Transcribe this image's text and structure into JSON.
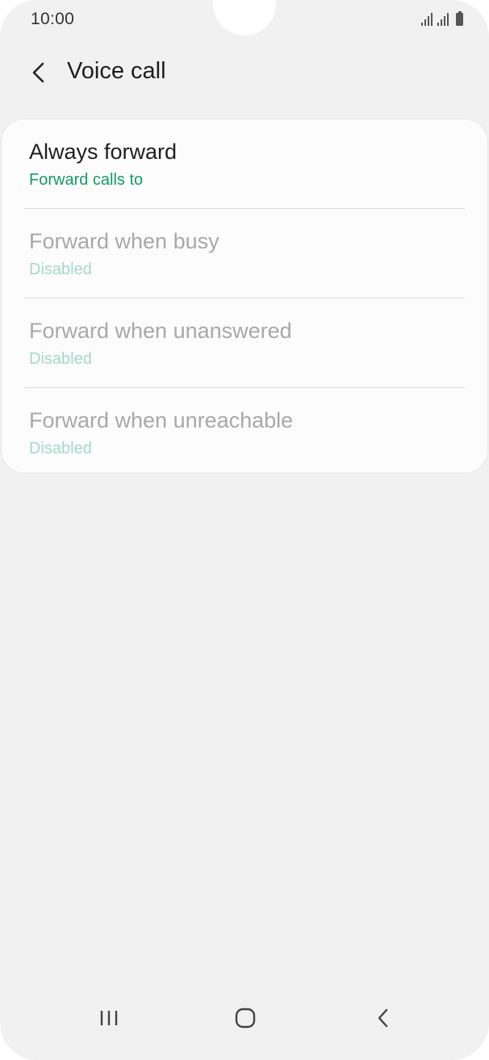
{
  "status_bar": {
    "time": "10:00",
    "icons": [
      "signal-icon",
      "signal-icon",
      "battery-icon"
    ]
  },
  "header": {
    "title": "Voice call",
    "back_icon": "chevron-left-icon"
  },
  "forwarding_options": [
    {
      "title": "Always forward",
      "subtitle": "Forward calls to",
      "enabled": true
    },
    {
      "title": "Forward when busy",
      "subtitle": "Disabled",
      "enabled": false
    },
    {
      "title": "Forward when unanswered",
      "subtitle": "Disabled",
      "enabled": false
    },
    {
      "title": "Forward when unreachable",
      "subtitle": "Disabled",
      "enabled": false
    }
  ],
  "nav_bar": {
    "recent_icon": "recent-apps-icon",
    "home_icon": "home-icon",
    "back_icon": "back-icon"
  },
  "colors": {
    "accent": "#179a67",
    "accent_disabled": "#a5d9c4",
    "background": "#f1f1f1",
    "card": "#fcfcfc"
  }
}
